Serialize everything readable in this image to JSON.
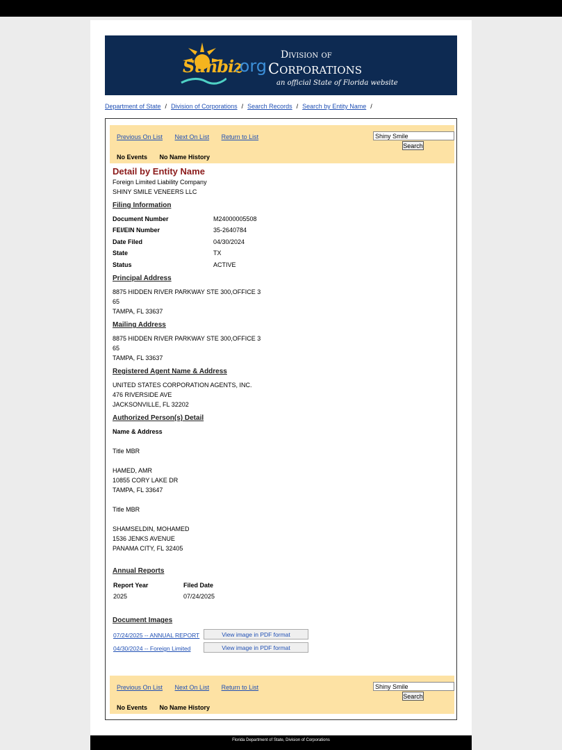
{
  "banner": {
    "logo_word": "Sunbiz",
    "logo_org": ".org",
    "division_of": "Division of",
    "corporations": "Corporations",
    "tagline": "an official State of Florida website"
  },
  "breadcrumb": [
    "Department of State",
    "Division of Corporations",
    "Search Records",
    "Search by Entity Name"
  ],
  "nav": {
    "prev": "Previous On List",
    "next": "Next On List",
    "return": "Return to List",
    "search_value": "Shiny Smile",
    "search_button": "Search",
    "no_events": "No Events",
    "no_name_history": "No Name History"
  },
  "detail": {
    "title": "Detail by Entity Name",
    "entity_type": "Foreign Limited Liability Company",
    "entity_name": "SHINY SMILE VENEERS LLC",
    "filing_info_heading": "Filing Information",
    "filing": [
      {
        "label": "Document Number",
        "value": "M24000005508"
      },
      {
        "label": "FEI/EIN Number",
        "value": "35-2640784"
      },
      {
        "label": "Date Filed",
        "value": "04/30/2024"
      },
      {
        "label": "State",
        "value": "TX"
      },
      {
        "label": "Status",
        "value": "ACTIVE"
      }
    ],
    "principal_heading": "Principal Address",
    "principal": [
      "8875 HIDDEN RIVER PARKWAY STE 300,OFFICE 3",
      "65",
      "TAMPA, FL 33637"
    ],
    "mailing_heading": "Mailing Address",
    "mailing": [
      "8875 HIDDEN RIVER PARKWAY STE 300,OFFICE 3",
      "65",
      "TAMPA, FL 33637"
    ],
    "agent_heading": "Registered Agent Name & Address",
    "agent": [
      "UNITED STATES CORPORATION AGENTS, INC.",
      "476 RIVERSIDE AVE",
      "JACKSONVILLE, FL 32202"
    ],
    "authorized_heading": "Authorized Person(s) Detail",
    "name_address_label": "Name & Address",
    "persons": [
      {
        "title": "Title MBR",
        "lines": [
          "HAMED, AMR",
          "10855 CORY LAKE DR",
          "TAMPA, FL 33647"
        ]
      },
      {
        "title": "Title MBR",
        "lines": [
          "SHAMSELDIN, MOHAMED",
          "1536 JENKS AVENUE",
          "PANAMA CITY, FL 32405"
        ]
      }
    ],
    "annual_heading": "Annual Reports",
    "annual_cols": [
      "Report Year",
      "Filed Date"
    ],
    "annual_rows": [
      [
        "2025",
        "07/24/2025"
      ]
    ],
    "docs_heading": "Document Images",
    "docs": [
      {
        "link": "07/24/2025 -- ANNUAL REPORT",
        "button": "View image in PDF format"
      },
      {
        "link": "04/30/2024 -- Foreign Limited",
        "button": "View image in PDF format"
      }
    ]
  },
  "footer": "Florida Department of State, Division of Corporations",
  "colors": {
    "banner_bg": "#0d2a52",
    "nav_bg": "#fde2a4",
    "title_red": "#8b1a1a",
    "link": "#1f4fb4"
  }
}
